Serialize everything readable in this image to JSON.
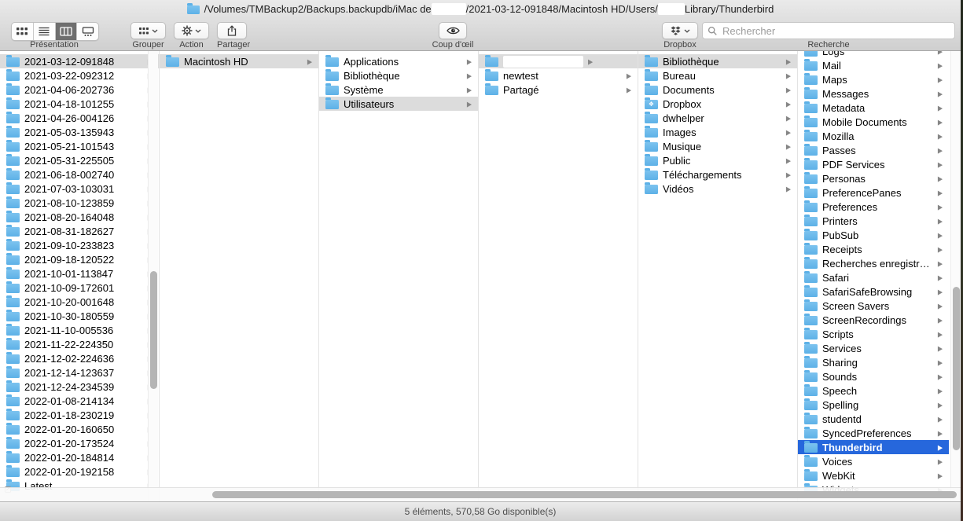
{
  "window": {
    "path_part1": "/Volumes/TMBackup2/Backups.backupdb/iMac de ",
    "path_part2": "/2021-03-12-091848/Macintosh HD/Users/",
    "path_part3": "Library/Thunderbird"
  },
  "toolbar": {
    "view_label": "Présentation",
    "group_label": "Grouper",
    "action_label": "Action",
    "share_label": "Partager",
    "quicklook_label": "Coup d'œil",
    "dropbox_label": "Dropbox",
    "search_label": "Recherche",
    "search_placeholder": "Rechercher"
  },
  "colors": {
    "selection_blue": "#2667dc",
    "selection_gray": "#dcdcdc",
    "folder_blue": "#5db1e7"
  },
  "columns": [
    {
      "items": [
        {
          "label": "2021-03-12-091848",
          "sel": "gray"
        },
        {
          "label": "2021-03-22-092312"
        },
        {
          "label": "2021-04-06-202736"
        },
        {
          "label": "2021-04-18-101255"
        },
        {
          "label": "2021-04-26-004126"
        },
        {
          "label": "2021-05-03-135943"
        },
        {
          "label": "2021-05-21-101543"
        },
        {
          "label": "2021-05-31-225505"
        },
        {
          "label": "2021-06-18-002740"
        },
        {
          "label": "2021-07-03-103031"
        },
        {
          "label": "2021-08-10-123859"
        },
        {
          "label": "2021-08-20-164048"
        },
        {
          "label": "2021-08-31-182627"
        },
        {
          "label": "2021-09-10-233823"
        },
        {
          "label": "2021-09-18-120522"
        },
        {
          "label": "2021-10-01-113847"
        },
        {
          "label": "2021-10-09-172601"
        },
        {
          "label": "2021-10-20-001648"
        },
        {
          "label": "2021-10-30-180559"
        },
        {
          "label": "2021-11-10-005536"
        },
        {
          "label": "2021-11-22-224350"
        },
        {
          "label": "2021-12-02-224636"
        },
        {
          "label": "2021-12-14-123637"
        },
        {
          "label": "2021-12-24-234539"
        },
        {
          "label": "2022-01-08-214134"
        },
        {
          "label": "2022-01-18-230219"
        },
        {
          "label": "2022-01-20-160650"
        },
        {
          "label": "2022-01-20-173524"
        },
        {
          "label": "2022-01-20-184814"
        },
        {
          "label": "2022-01-20-192158"
        },
        {
          "label": "Latest",
          "badge": "alias"
        }
      ]
    },
    {
      "items": [
        {
          "label": "Macintosh HD",
          "sel": "gray"
        }
      ]
    },
    {
      "items": [
        {
          "label": "Applications"
        },
        {
          "label": "Bibliothèque"
        },
        {
          "label": "Système"
        },
        {
          "label": "Utilisateurs",
          "sel": "gray"
        }
      ]
    },
    {
      "items": [
        {
          "label": "",
          "sel": "gray",
          "redacted": true
        },
        {
          "label": "newtest"
        },
        {
          "label": "Partagé"
        }
      ]
    },
    {
      "items": [
        {
          "label": "Bibliothèque",
          "sel": "gray"
        },
        {
          "label": "Bureau"
        },
        {
          "label": "Documents"
        },
        {
          "label": "Dropbox",
          "badge": "dropbox"
        },
        {
          "label": "dwhelper"
        },
        {
          "label": "Images"
        },
        {
          "label": "Musique"
        },
        {
          "label": "Public"
        },
        {
          "label": "Téléchargements"
        },
        {
          "label": "Vidéos"
        }
      ]
    },
    {
      "items": [
        {
          "label": "Logs",
          "clipped": true
        },
        {
          "label": "Mail"
        },
        {
          "label": "Maps"
        },
        {
          "label": "Messages"
        },
        {
          "label": "Metadata"
        },
        {
          "label": "Mobile Documents"
        },
        {
          "label": "Mozilla"
        },
        {
          "label": "Passes"
        },
        {
          "label": "PDF Services"
        },
        {
          "label": "Personas"
        },
        {
          "label": "PreferencePanes"
        },
        {
          "label": "Preferences"
        },
        {
          "label": "Printers"
        },
        {
          "label": "PubSub"
        },
        {
          "label": "Receipts"
        },
        {
          "label": "Recherches enregistrées"
        },
        {
          "label": "Safari"
        },
        {
          "label": "SafariSafeBrowsing"
        },
        {
          "label": "Screen Savers"
        },
        {
          "label": "ScreenRecordings"
        },
        {
          "label": "Scripts"
        },
        {
          "label": "Services"
        },
        {
          "label": "Sharing"
        },
        {
          "label": "Sounds"
        },
        {
          "label": "Speech"
        },
        {
          "label": "Spelling"
        },
        {
          "label": "studentd"
        },
        {
          "label": "SyncedPreferences"
        },
        {
          "label": "Thunderbird",
          "sel": "blue"
        },
        {
          "label": "Voices"
        },
        {
          "label": "WebKit"
        },
        {
          "label": "Widgets"
        }
      ]
    }
  ],
  "statusbar": {
    "text": "5 éléments, 570,58 Go disponible(s)"
  }
}
